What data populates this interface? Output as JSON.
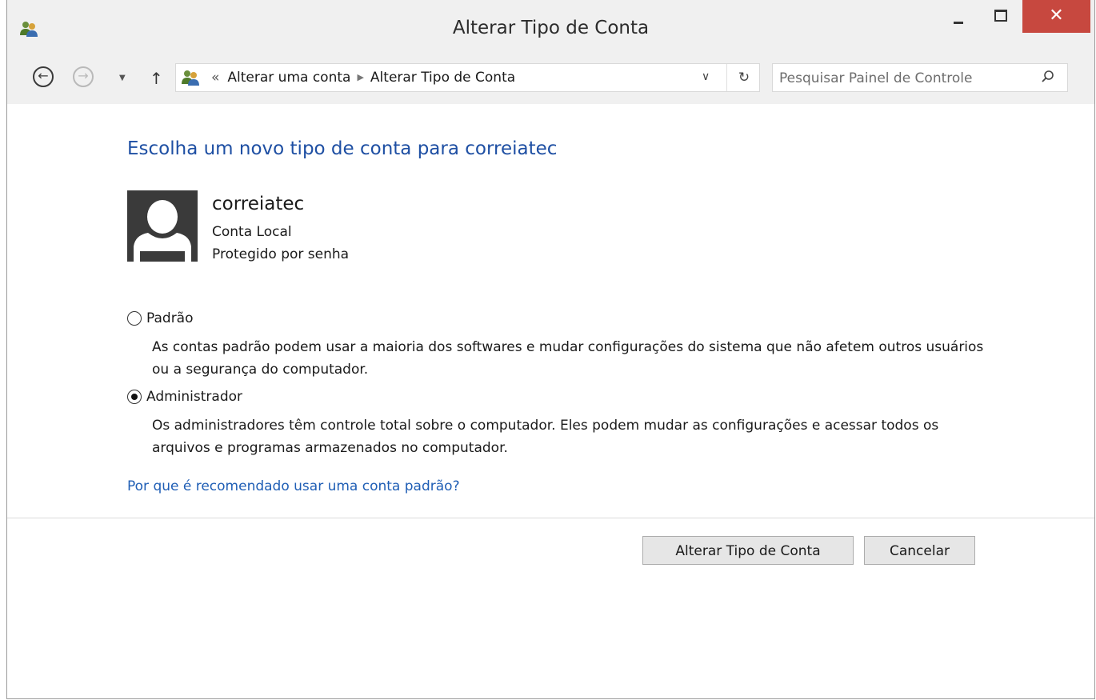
{
  "window": {
    "title": "Alterar Tipo de Conta",
    "close_glyph": "✕"
  },
  "nav": {
    "back_glyph": "←",
    "forward_glyph": "→",
    "recent_glyph": "▼",
    "up_glyph": "↑"
  },
  "address": {
    "prefix": "«",
    "crumbs": [
      "Alterar uma conta",
      "Alterar Tipo de Conta"
    ],
    "separator": "▶",
    "dropdown_glyph": "∨",
    "refresh_glyph": "↻"
  },
  "search": {
    "placeholder": "Pesquisar Painel de Controle",
    "value": ""
  },
  "content": {
    "heading": "Escolha um novo tipo de conta para correiatec",
    "user": {
      "name": "correiatec",
      "type": "Conta Local",
      "protection": "Protegido por senha"
    },
    "options": [
      {
        "label": "Padrão",
        "description": "As contas padrão podem usar a maioria dos softwares e mudar configurações do sistema que não afetem outros usuários ou a segurança do computador.",
        "checked": false
      },
      {
        "label": "Administrador",
        "description": "Os administradores têm controle total sobre o computador. Eles podem mudar as configurações e acessar todos os arquivos e programas armazenados no computador.",
        "checked": true
      }
    ],
    "help_link": "Por que é recomendado usar uma conta padrão?"
  },
  "buttons": {
    "change": "Alterar Tipo de Conta",
    "cancel": "Cancelar"
  },
  "colors": {
    "heading": "#1e4fa3",
    "link": "#1f5eb5",
    "close_button": "#c7483f",
    "chrome": "#f0f0f0"
  },
  "icons": {
    "app": "users-icon",
    "address": "users-icon",
    "search": "search-icon",
    "avatar": "user-silhouette-icon"
  }
}
